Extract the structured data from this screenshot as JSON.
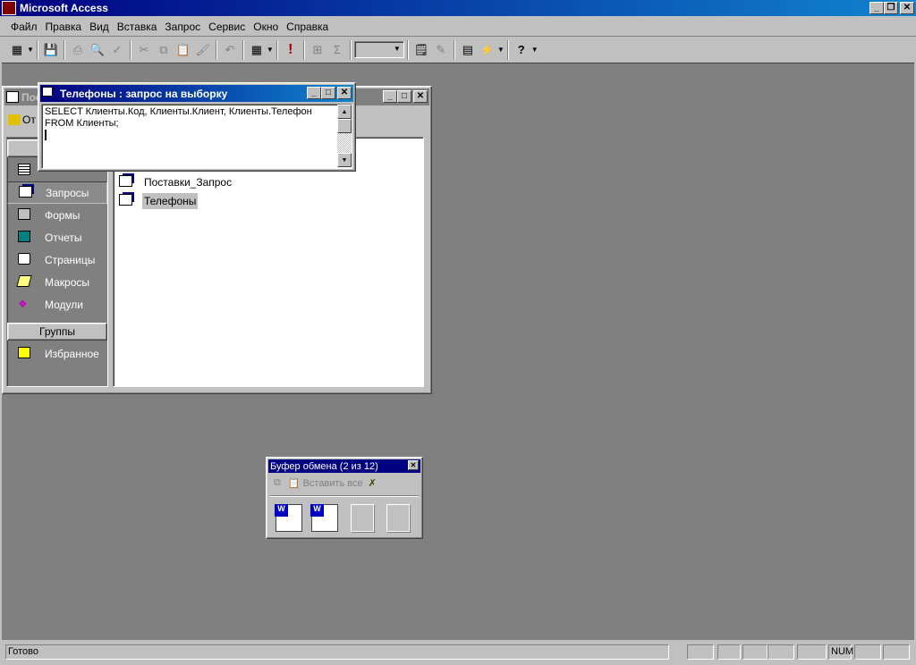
{
  "app": {
    "title": "Microsoft Access"
  },
  "menu": [
    "Файл",
    "Правка",
    "Вид",
    "Вставка",
    "Запрос",
    "Сервис",
    "Окно",
    "Справка"
  ],
  "toolbar": {
    "icons": [
      "datasheet-view-icon",
      "save-icon",
      "print-icon",
      "print-preview-icon",
      "spelling-icon",
      "cut-icon",
      "copy-icon",
      "paste-icon",
      "format-painter-icon",
      "undo-icon",
      "query-type-icon",
      "run-icon",
      "show-table-icon",
      "totals-icon",
      "properties-icon",
      "build-icon",
      "database-window-icon",
      "new-object-icon",
      "help-icon"
    ],
    "combo_value": ""
  },
  "db_window": {
    "title_visible": "Пос",
    "open_label_visible": "От",
    "groups_label": "Группы",
    "objects": [
      {
        "label": "Запросы",
        "icon": "query-icon"
      },
      {
        "label": "Формы",
        "icon": "form-icon"
      },
      {
        "label": "Отчеты",
        "icon": "report-icon"
      },
      {
        "label": "Страницы",
        "icon": "page-icon"
      },
      {
        "label": "Макросы",
        "icon": "macro-icon"
      },
      {
        "label": "Модули",
        "icon": "module-icon"
      }
    ],
    "favorites": "Избранное",
    "list": [
      "Поставки_Запрос",
      "Телефоны"
    ]
  },
  "query_window": {
    "title": "Телефоны : запрос на выборку",
    "sql_line1": "SELECT Клиенты.Код, Клиенты.Клиент, Клиенты.Телефон",
    "sql_line2": "FROM Клиенты;"
  },
  "clipboard": {
    "title": "Буфер обмена (2 из 12)",
    "paste_all": "Вставить все"
  },
  "status": {
    "text": "Готово",
    "num": "NUM"
  },
  "colors": {
    "titlebar": "#000080",
    "workspace": "#808080",
    "face": "#c0c0c0"
  }
}
